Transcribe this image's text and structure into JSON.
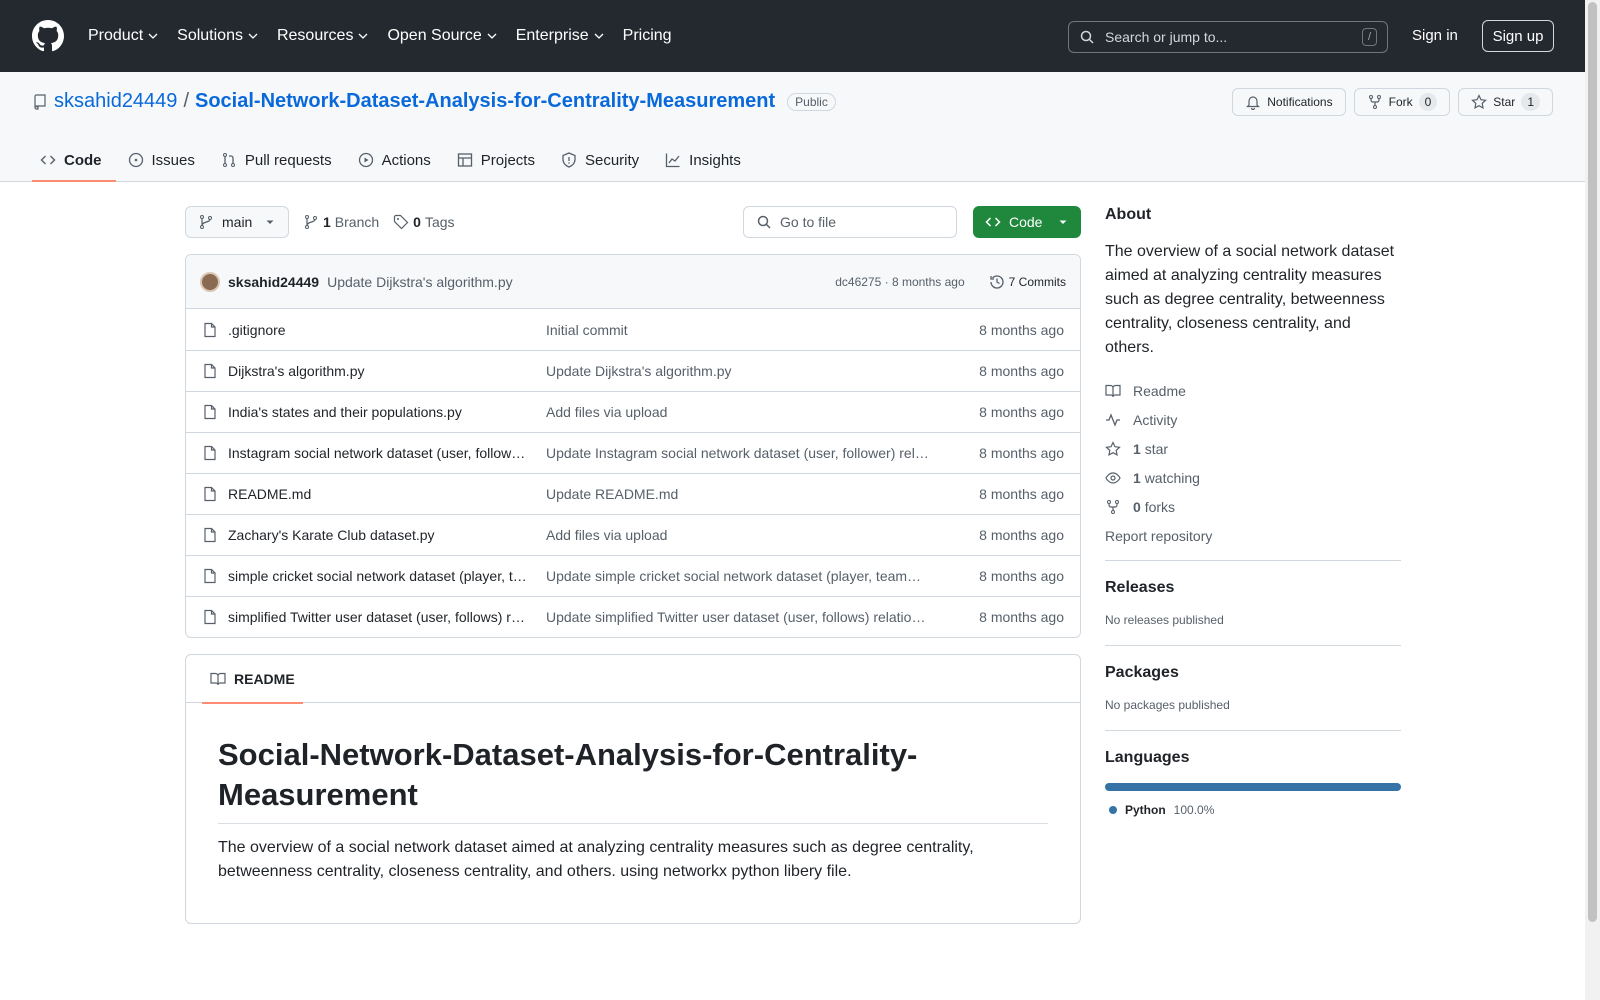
{
  "header": {
    "nav": [
      "Product",
      "Solutions",
      "Resources",
      "Open Source",
      "Enterprise",
      "Pricing"
    ],
    "search_placeholder": "Search or jump to...",
    "search_shortcut": "/",
    "signin": "Sign in",
    "signup": "Sign up"
  },
  "repo": {
    "owner": "sksahid24449",
    "separator": "/",
    "name": "Social-Network-Dataset-Analysis-for-Centrality-Measurement",
    "visibility": "Public",
    "notifications_label": "Notifications",
    "fork_label": "Fork",
    "fork_count": "0",
    "star_label": "Star",
    "star_count": "1"
  },
  "tabs": [
    {
      "label": "Code",
      "icon": "code-icon"
    },
    {
      "label": "Issues",
      "icon": "issue-icon"
    },
    {
      "label": "Pull requests",
      "icon": "pull-request-icon"
    },
    {
      "label": "Actions",
      "icon": "play-icon"
    },
    {
      "label": "Projects",
      "icon": "table-icon"
    },
    {
      "label": "Security",
      "icon": "shield-icon"
    },
    {
      "label": "Insights",
      "icon": "graph-icon"
    }
  ],
  "toolbar": {
    "branch": "main",
    "branch_count": "1",
    "branch_label": "Branch",
    "tag_count": "0",
    "tag_label": "Tags",
    "goto_placeholder": "Go to file",
    "code_button": "Code"
  },
  "latest_commit": {
    "author": "sksahid24449",
    "message": "Update Dijkstra's algorithm.py",
    "hash_time": "dc46275 · 8 months ago",
    "commits_label": "7 Commits"
  },
  "files": [
    {
      "name": ".gitignore",
      "commit": "Initial commit",
      "age": "8 months ago"
    },
    {
      "name": "Dijkstra's algorithm.py",
      "commit": "Update Dijkstra's algorithm.py",
      "age": "8 months ago"
    },
    {
      "name": "India's states and their populations.py",
      "commit": "Add files via upload",
      "age": "8 months ago"
    },
    {
      "name": "Instagram social network dataset (user, follow…",
      "commit": "Update Instagram social network dataset (user, follower) rel…",
      "age": "8 months ago"
    },
    {
      "name": "README.md",
      "commit": "Update README.md",
      "age": "8 months ago"
    },
    {
      "name": "Zachary's Karate Club dataset.py",
      "commit": "Add files via upload",
      "age": "8 months ago"
    },
    {
      "name": "simple cricket social network dataset (player, t…",
      "commit": "Update simple cricket social network dataset (player, team…",
      "age": "8 months ago"
    },
    {
      "name": "simplified Twitter user dataset (user, follows) r…",
      "commit": "Update simplified Twitter user dataset (user, follows) relatio…",
      "age": "8 months ago"
    }
  ],
  "readme": {
    "tab_label": "README",
    "title": "Social-Network-Dataset-Analysis-for-Centrality-Measurement",
    "body": "The overview of a social network dataset aimed at analyzing centrality measures such as degree centrality, betweenness centrality, closeness centrality, and others. using networkx python libery file."
  },
  "about": {
    "heading": "About",
    "description": "The overview of a social network dataset aimed at analyzing centrality measures such as degree centrality, betweenness centrality, closeness centrality, and others.",
    "readme": "Readme",
    "activity": "Activity",
    "stars_count": "1",
    "stars_label": "star",
    "watching_count": "1",
    "watching_label": "watching",
    "forks_count": "0",
    "forks_label": "forks",
    "report": "Report repository"
  },
  "releases": {
    "heading": "Releases",
    "empty": "No releases published"
  },
  "packages": {
    "heading": "Packages",
    "empty": "No packages published"
  },
  "languages": {
    "heading": "Languages",
    "items": [
      {
        "name": "Python",
        "percent": "100.0%",
        "share": 1.0,
        "color": "#3572a5"
      }
    ]
  },
  "colors": {
    "header_bg": "#24292f",
    "link": "#0969da",
    "primary_button": "#1f883d",
    "tab_underline": "#fd8c73"
  }
}
